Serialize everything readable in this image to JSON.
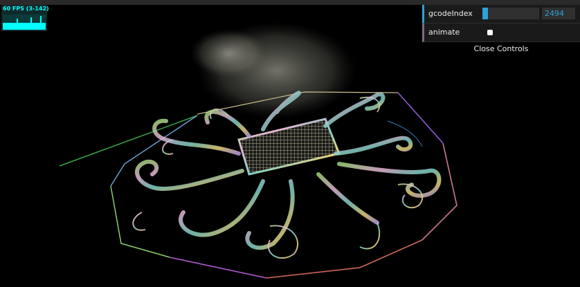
{
  "stats": {
    "fps_text": "60 FPS (3-142)"
  },
  "gui": {
    "controllers": [
      {
        "label": "gcodeIndex",
        "value": "2494",
        "slider_fraction": 0.1
      },
      {
        "label": "animate",
        "checked": false
      }
    ],
    "close_label": "Close Controls"
  },
  "colors": {
    "background": "#000000",
    "gui_bg": "#1a1a1a",
    "number_accent": "#2fa1d6",
    "boolean_accent": "#806787",
    "fps_text": "#00ffff"
  },
  "scene": {
    "description_icon": "gcode-toolpath-render-octopus"
  }
}
